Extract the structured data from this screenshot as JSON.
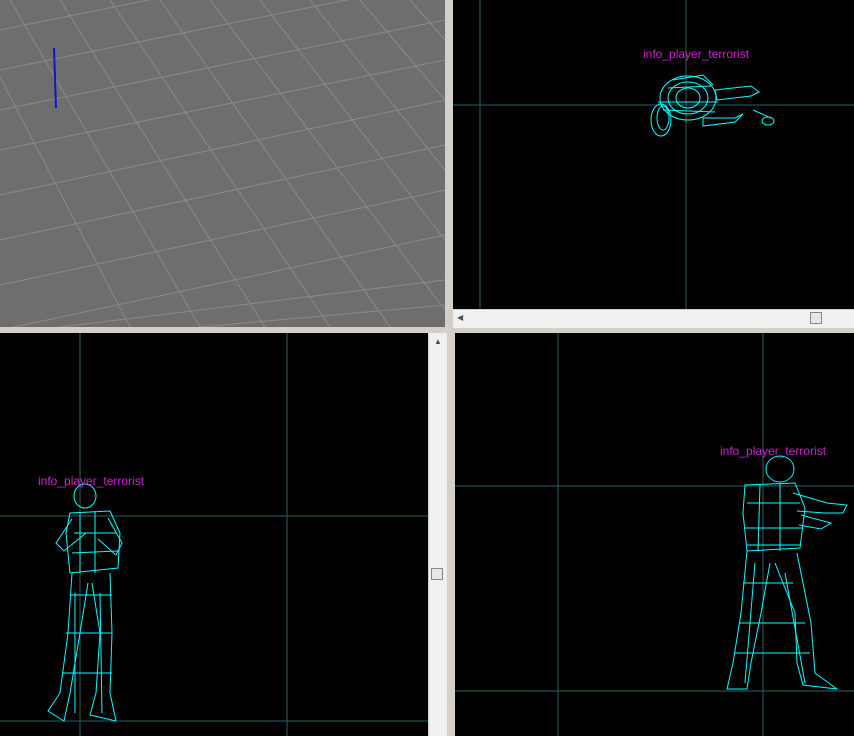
{
  "viewports": {
    "camera_3d": {
      "grid_color": "#8c8c8c",
      "background": "#6e6e6e",
      "axis_color": "#1515c8"
    },
    "top": {
      "entity_label": "info_player_terrorist"
    },
    "front": {
      "entity_label": "info_player_terrorist"
    },
    "side": {
      "entity_label": "info_player_terrorist"
    }
  },
  "colors": {
    "entity_label": "#d41ed4",
    "wireframe": "#00ffff",
    "grid_line": "#2f6f7a",
    "grid_line_major": "#3c5b63"
  },
  "icons": {
    "scroll_left": "triangle-left",
    "scroll_up": "triangle-up"
  }
}
